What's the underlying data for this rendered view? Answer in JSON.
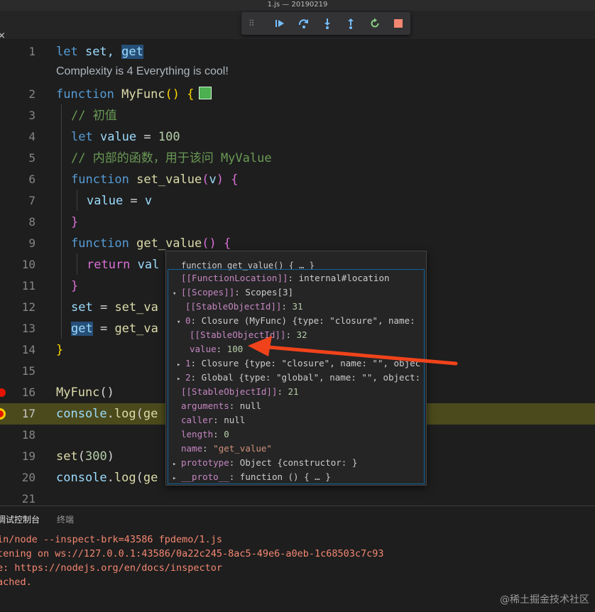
{
  "window": {
    "title": "1.js — 20190219"
  },
  "tab": {
    "close_glyph": "×"
  },
  "debug_toolbar": {
    "grip": "⠿",
    "buttons": [
      {
        "name": "continue-icon",
        "color": "#75beff"
      },
      {
        "name": "step-over-icon",
        "color": "#75beff"
      },
      {
        "name": "step-into-icon",
        "color": "#75beff"
      },
      {
        "name": "step-out-icon",
        "color": "#75beff"
      },
      {
        "name": "restart-icon",
        "color": "#89d185"
      },
      {
        "name": "stop-icon",
        "color": "#f48771"
      }
    ]
  },
  "editor": {
    "line_numbers": [
      "1",
      "2",
      "3",
      "4",
      "5",
      "6",
      "7",
      "8",
      "9",
      "10",
      "11",
      "12",
      "13",
      "14",
      "15",
      "16",
      "17",
      "18",
      "19",
      "20",
      "21"
    ],
    "codelens": "Complexity is 4 Everything is cool!",
    "lines": {
      "l1": {
        "kw": "let",
        "a": " set, ",
        "b": "get"
      },
      "l2": {
        "kw": "function",
        "name": " MyFunc",
        "paren": "()",
        "brace": " {"
      },
      "l3": {
        "comment": "// 初值"
      },
      "l4": {
        "kw": "let",
        "var": " value",
        "op": " = ",
        "num": "100"
      },
      "l5": {
        "comment": "// 内部的函数，用于该问 MyValue"
      },
      "l6": {
        "kw": "function",
        "name": " set_value",
        "p1": "(",
        "arg": "v",
        "p2": ")",
        "brace": " {"
      },
      "l7": {
        "var": "value",
        "op": " = ",
        "arg": "v"
      },
      "l8": {
        "brace": "}"
      },
      "l9": {
        "kw": "function",
        "name": " get_value",
        "paren": "()",
        "brace": " {"
      },
      "l10": {
        "kw": "return",
        "rest": " val"
      },
      "l11": {
        "brace": "}"
      },
      "l12": {
        "var": "set",
        "op": " = ",
        "rest": "set_va"
      },
      "l13": {
        "var": "get",
        "op": " = ",
        "rest": "get_va"
      },
      "l14": {
        "brace": "}"
      },
      "l16": {
        "fn": "MyFunc",
        "paren": "()"
      },
      "l17": {
        "obj": "console",
        "dot": ".",
        "fn": "log",
        "p": "(",
        "rest": "ge"
      },
      "l19": {
        "fn": "set",
        "p1": "(",
        "num": "300",
        "p2": ")"
      },
      "l20": {
        "obj": "console",
        "dot": ".",
        "fn": "log",
        "p": "(",
        "rest": "ge"
      }
    }
  },
  "hover": {
    "header": "function get_value() { … }",
    "rows": {
      "r1": {
        "key": "[[FunctionLocation]]",
        "sep": ": ",
        "val": "internal#location"
      },
      "r2": {
        "twisty": "▾",
        "key": "[[Scopes]]",
        "sep": ": ",
        "val": "Scopes[3]"
      },
      "r3": {
        "key": "[[StableObjectId]]",
        "sep": ": ",
        "num": "31"
      },
      "r4": {
        "twisty": "▾",
        "key": "0",
        "sep": ": ",
        "val": "Closure (MyFunc) {type: \"closure\", name:"
      },
      "r5": {
        "key": "[[StableObjectId]]",
        "sep": ": ",
        "num": "32"
      },
      "r6": {
        "key": "value",
        "sep": ": ",
        "num": "100"
      },
      "r7": {
        "twisty": "▸",
        "key": "1",
        "sep": ": ",
        "val": "Closure {type: \"closure\", name: \"\", objec"
      },
      "r8": {
        "twisty": "▸",
        "key": "2",
        "sep": ": ",
        "val": "Global {type: \"global\", name: \"\", object:"
      },
      "r9": {
        "key": "[[StableObjectId]]",
        "sep": ": ",
        "num": "21"
      },
      "r10": {
        "key": "arguments",
        "sep": ": ",
        "val": "null"
      },
      "r11": {
        "key": "caller",
        "sep": ": ",
        "val": "null"
      },
      "r12": {
        "key": "length",
        "sep": ": ",
        "num": "0"
      },
      "r13": {
        "key": "name",
        "sep": ": ",
        "str": "\"get_value\""
      },
      "r14": {
        "twisty": "▸",
        "key": "prototype",
        "sep": ": ",
        "val": "Object {constructor: }"
      },
      "r15": {
        "twisty": "▸",
        "key": "__proto__",
        "sep": ": ",
        "val": "function () { … }"
      }
    }
  },
  "panel": {
    "tabs": [
      "调试控制台",
      "终端"
    ],
    "output": [
      "in/node --inspect-brk=43586 fpdemo/1.js",
      "tening on ws://127.0.0.1:43586/0a22c245-8ac5-49e6-a0eb-1c68503c7c93",
      "e: https://nodejs.org/en/docs/inspector",
      "ached."
    ]
  },
  "watermark": "@稀土掘金技术社区"
}
